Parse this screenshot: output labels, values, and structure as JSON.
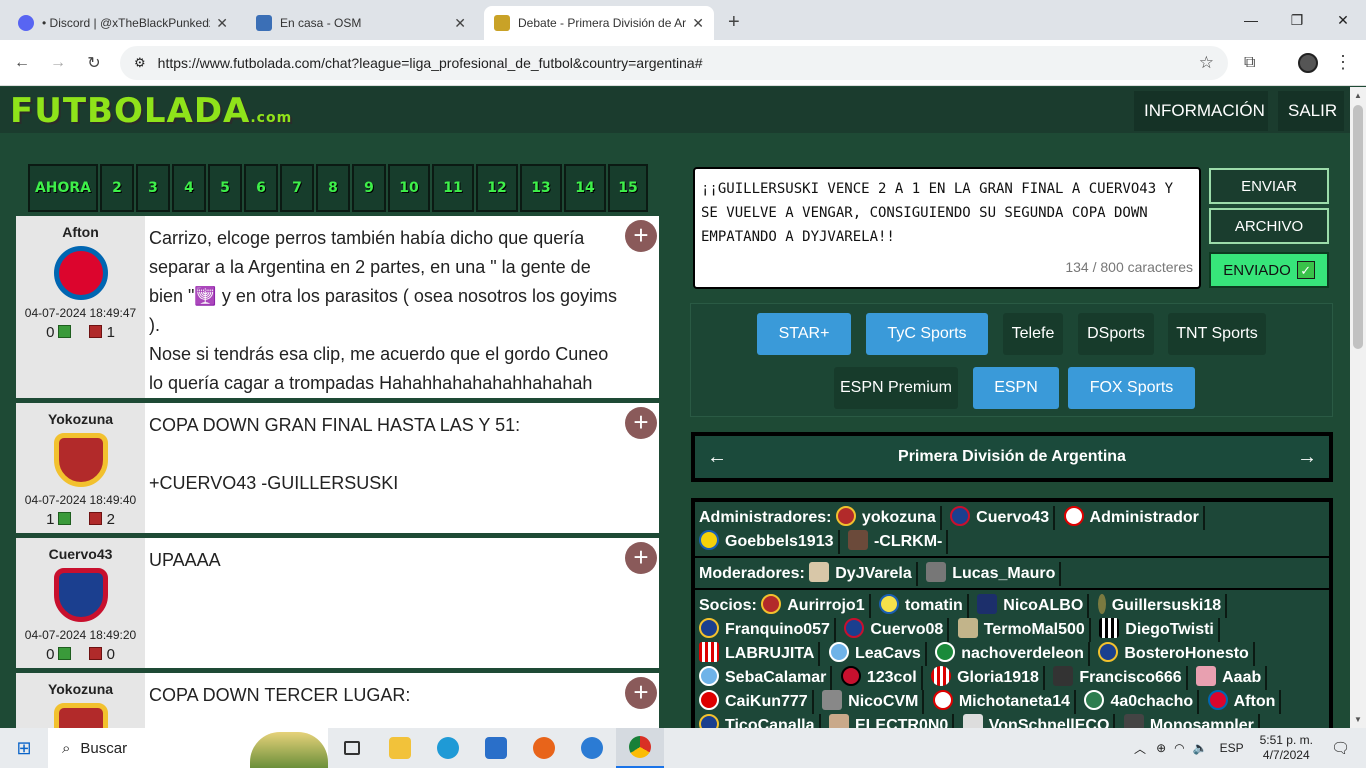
{
  "browser": {
    "tabs": [
      {
        "title": "• Discord | @xTheBlackPunkedx",
        "color": "#5865f2",
        "active": false
      },
      {
        "title": "En casa - OSM",
        "color": "#3b6fb6",
        "active": false
      },
      {
        "title": "Debate - Primera División de Ar",
        "color": "#c9a227",
        "active": true
      }
    ],
    "new_tab": "+",
    "url": "https://www.futbolada.com/chat?league=liga_profesional_de_futbol&country=argentina#"
  },
  "site": {
    "logo": "FUTBOLADA",
    "logo_suffix": ".com",
    "nav": [
      {
        "label": "INFORMACIÓN"
      },
      {
        "label": "SALIR"
      }
    ]
  },
  "pages": [
    "AHORA",
    "2",
    "3",
    "4",
    "5",
    "6",
    "7",
    "8",
    "9",
    "10",
    "11",
    "12",
    "13",
    "14",
    "15"
  ],
  "posts": [
    {
      "user": "Afton",
      "badge_color": "#dc052d",
      "badge_ring": "#0066b2",
      "date": "04-07-2024 18:49:47",
      "up": "0",
      "down": "1",
      "text": "Carrizo, elcoge perros también había dicho que quería separar a la Argentina en 2 partes, en una \" la gente de bien \"🕎 y en otra los parasitos ( osea nosotros los goyims ).\nNose si tendrás esa clip, me acuerdo que el gordo Cuneo lo quería cagar a trompadas Hahahhahahahahhahahah"
    },
    {
      "user": "Yokozuna",
      "badge_color": "#b22a2a",
      "badge_ring": "#f2c12e",
      "date": "04-07-2024 18:49:40",
      "up": "1",
      "down": "2",
      "text": "COPA DOWN GRAN FINAL HASTA LAS Y 51:\n\n+CUERVO43 -GUILLERSUSKI"
    },
    {
      "user": "Cuervo43",
      "badge_color": "#1b3f8f",
      "badge_ring": "#c8102e",
      "date": "04-07-2024 18:49:20",
      "up": "0",
      "down": "0",
      "text": "UPAAAA"
    },
    {
      "user": "Yokozuna",
      "badge_color": "#b22a2a",
      "badge_ring": "#f2c12e",
      "date": "",
      "up": "",
      "down": "",
      "text": "COPA DOWN TERCER LUGAR:"
    }
  ],
  "compose": {
    "message": "¡¡GUILLERSUSKI VENCE 2 A 1 EN LA GRAN FINAL A CUERVO43 Y SE VUELVE A VENGAR, CONSIGUIENDO SU SEGUNDA COPA DOWN EMPATANDO A DYJVARELA!!",
    "counter": "134 / 800 caracteres",
    "send_label": "ENVIAR",
    "file_label": "ARCHIVO",
    "sent_label": "ENVIADO"
  },
  "tv": [
    {
      "label": "STAR+",
      "style": "blue"
    },
    {
      "label": "TyC Sports",
      "style": "blue"
    },
    {
      "label": "Telefe",
      "style": "dark"
    },
    {
      "label": "DSports",
      "style": "dark"
    },
    {
      "label": "TNT Sports",
      "style": "dark"
    },
    {
      "label": "ESPN Premium",
      "style": "dark"
    },
    {
      "label": "ESPN",
      "style": "blue"
    },
    {
      "label": "FOX Sports",
      "style": "blue"
    }
  ],
  "league": {
    "title": "Primera División de Argentina",
    "prev": "←",
    "next": "→"
  },
  "members": {
    "admins_label": "Administradores:",
    "admins": [
      "yokozuna",
      "Cuervo43",
      "Administrador",
      "Goebbels1913",
      "-CLRKM-"
    ],
    "mods_label": "Moderadores:",
    "mods": [
      "DyJVarela",
      "Lucas_Mauro"
    ],
    "socios_label": "Socios:",
    "socios": [
      "Aurirrojo1",
      "tomatin",
      "NicoALBO",
      "Guillersuski18",
      "Franquino057",
      "Cuervo08",
      "TermoMal500",
      "DiegoTwisti",
      "LABRUJITA",
      "LeaCavs",
      "nachoverdeleon",
      "BosteroHonesto",
      "SebaCalamar",
      "123col",
      "Gloria1918",
      "Francisco666",
      "Aaab",
      "CaiKun777",
      "NicoCVM",
      "Michotaneta14",
      "4a0chacho",
      "Afton",
      "TicoCanalla",
      "ELECTR0N0",
      "VonSchnellECO",
      "Monosampler"
    ]
  },
  "taskbar": {
    "search": "Buscar",
    "lang": "ESP",
    "time": "5:51 p. m.",
    "date": "4/7/2024"
  }
}
